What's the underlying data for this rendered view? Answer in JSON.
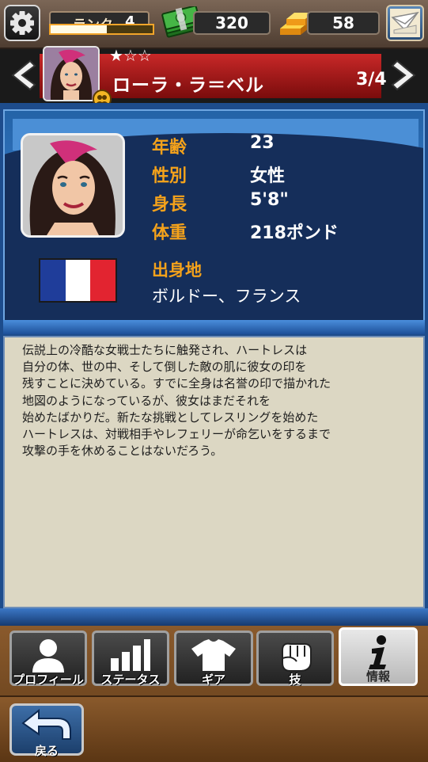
{
  "topbar": {
    "settings_icon": "gear-icon",
    "rank_label": "ランク",
    "rank_value": "4",
    "rank_progress": 0.55,
    "cash_icon": "cash-stack-icon",
    "cash_value": "320",
    "gold_icon": "gold-bars-icon",
    "gold_value": "58",
    "mail_icon": "mail-icon"
  },
  "header": {
    "stars_filled": 1,
    "stars_total": 3,
    "character_name": "ローラ・ラ＝ベル",
    "page_count": "3/4"
  },
  "profile": {
    "age_label": "年齢",
    "age_value": "23",
    "gender_label": "性別",
    "gender_value": "女性",
    "height_label": "身長",
    "height_value": "5'8\"",
    "weight_label": "体重",
    "weight_value": "218ポンド",
    "origin_label": "出身地",
    "origin_value": "ボルドー、フランス",
    "flag_colors": [
      "#1f3d9a",
      "#ffffff",
      "#e22430"
    ]
  },
  "bio": {
    "text": "伝説上の冷酷な女戦士たちに触発され、ハートレスは\n自分の体、世の中、そして倒した敵の肌に彼女の印を\n残すことに決めている。すでに全身は名誉の印で描かれた\n地図のようになっているが、彼女はまだそれを\n始めたばかりだ。新たな挑戦としてレスリングを始めた\nハートレスは、対戦相手やレフェリーが命乞いをするまで\n攻撃の手を休めることはないだろう。"
  },
  "tabs": [
    {
      "label": "プロフィール",
      "icon": "person-icon",
      "active": false
    },
    {
      "label": "ステータス",
      "icon": "bar-chart-icon",
      "active": false
    },
    {
      "label": "ギア",
      "icon": "shirt-icon",
      "active": false
    },
    {
      "label": "技",
      "icon": "fist-icon",
      "active": false
    },
    {
      "label": "情報",
      "icon": "info-icon",
      "active": true
    }
  ],
  "back": {
    "label": "戻る",
    "icon": "back-arrow-icon"
  }
}
